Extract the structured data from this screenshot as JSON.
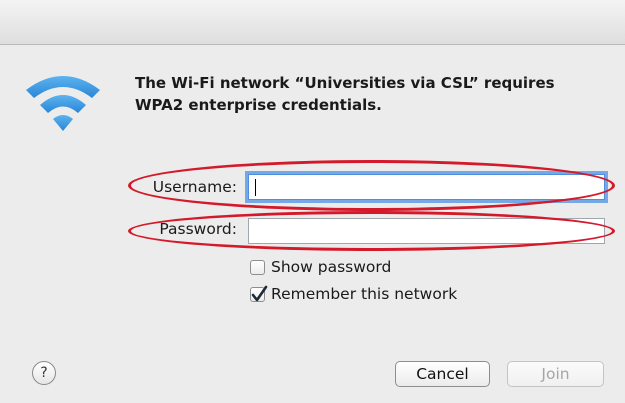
{
  "dialog": {
    "message": "The Wi-Fi network “Universities via CSL” requires WPA2 enterprise credentials.",
    "icon": "wifi-icon"
  },
  "form": {
    "username_label": "Username:",
    "username_value": "",
    "password_label": "Password:",
    "password_value": "",
    "show_password_label": "Show password",
    "show_password_checked": false,
    "remember_label": "Remember this network",
    "remember_checked": true
  },
  "buttons": {
    "help_label": "?",
    "cancel_label": "Cancel",
    "join_label": "Join",
    "join_enabled": false
  },
  "colors": {
    "wifi": "#3f97e0",
    "focus_ring": "#76a8e6",
    "annotation": "#d41a2a"
  }
}
